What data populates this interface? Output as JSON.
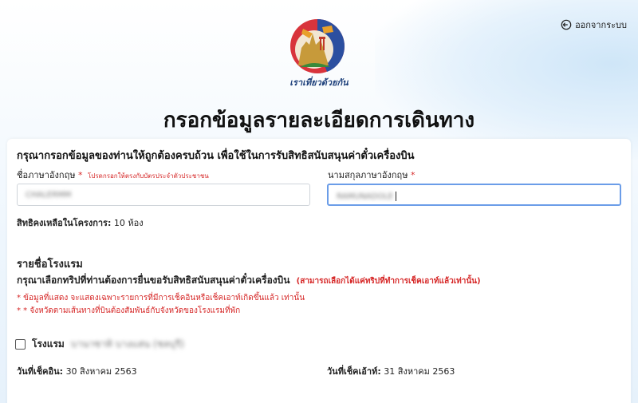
{
  "header": {
    "logout_label": "ออกจากระบบ",
    "logo_caption": "เราเที่ยวด้วยกัน"
  },
  "page_title": "กรอกข้อมูลรายละเอียดการเดินทาง",
  "form": {
    "intro": "กรุณากรอกข้อมูลของท่านให้ถูกต้องครบถ้วน เพื่อใช้ในการรับสิทธิสนับสนุนค่าตั๋วเครื่องบิน",
    "first_name_label": "ชื่อภาษาอังกฤษ",
    "first_name_hint": "โปรดกรอกให้ตรงกับบัตรประจำตัวประชาชน",
    "first_name_value": "CHALERMM",
    "last_name_label": "นามสกุลภาษาอังกฤษ",
    "last_name_value": "RAMUNADOLE",
    "required_mark": "*",
    "quota_label": "สิทธิคงเหลือในโครงการ:",
    "quota_value": "10 ห้อง"
  },
  "hotels": {
    "section_title": "รายชื่อโรงแรม",
    "instruction": "กรุณาเลือกทริปที่ท่านต้องการยื่นขอรับสิทธิสนับสนุนค่าตั๋วเครื่องบิน",
    "instruction_note": "(สามารถเลือกได้แค่ทริปที่ทำการเช็คเอาท์แล้วเท่านั้น)",
    "note_1": "* ข้อมูลที่แสดง จะแสดงเฉพาะรายการที่มีการเช็คอินหรือเช็คเอาท์เกิดขึ้นแล้ว เท่านั้น",
    "note_2": "* * จังหวัดตามเส้นทางที่บินต้องสัมพันธ์กับจังหวัดของโรงแรมที่พัก",
    "hotel_label": "โรงแรม",
    "hotel_name": "บานาซาทิ บางแสน (ชลบุรี)",
    "checkin_label": "วันที่เช็คอิน:",
    "checkin_value": "30 สิงหาคม 2563",
    "checkout_label": "วันที่เช็คเอ้าท์:",
    "checkout_value": "31 สิงหาคม 2563"
  },
  "colors": {
    "accent_red": "#d62828",
    "focus_blue": "#6b9de8",
    "logo_red": "#d8343c",
    "logo_blue": "#2b4fa0"
  }
}
